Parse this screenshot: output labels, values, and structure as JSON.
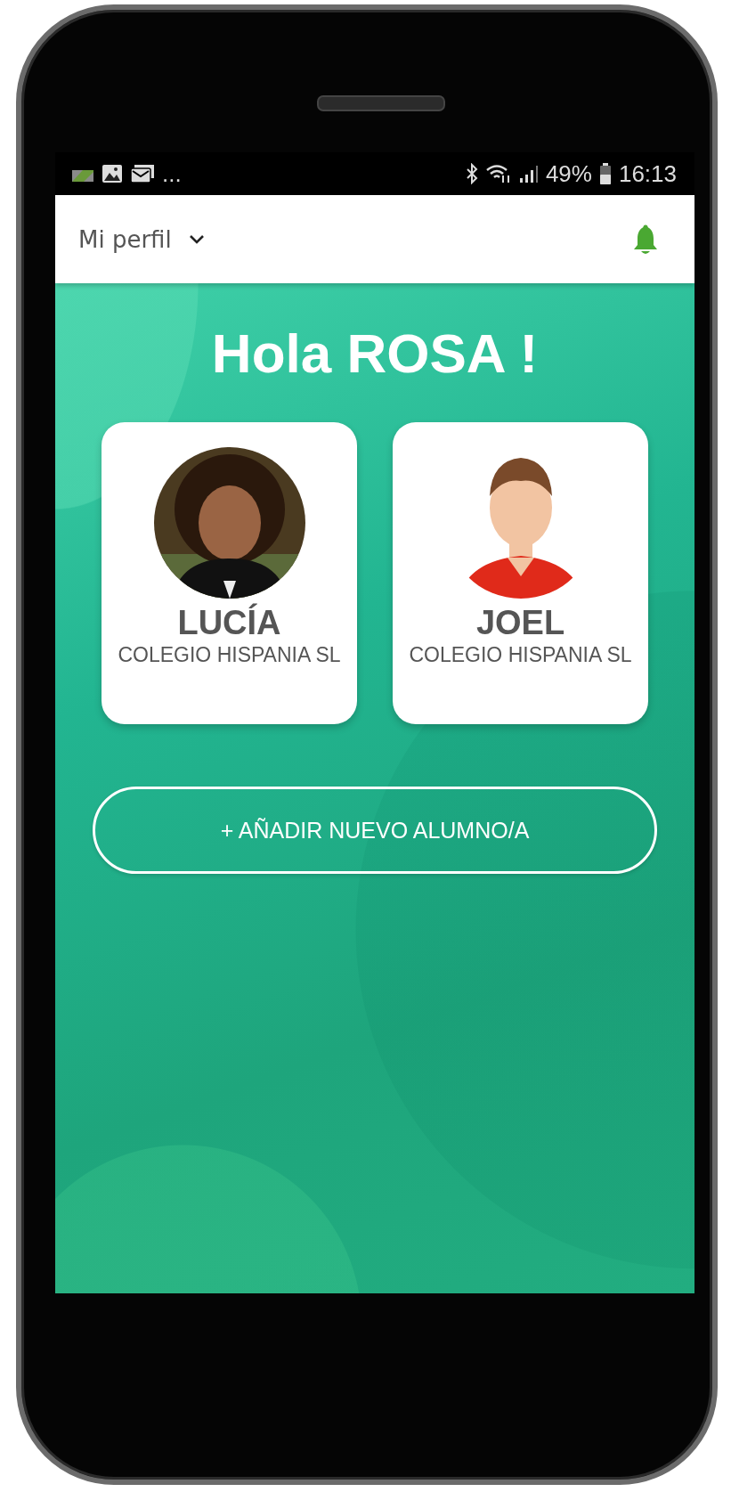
{
  "status_bar": {
    "more": "...",
    "battery": "49%",
    "time": "16:13"
  },
  "app_bar": {
    "title": "Mi perfil"
  },
  "greeting": "Hola ROSA !",
  "students": [
    {
      "name": "LUCÍA",
      "school": "COLEGIO HISPANIA SL"
    },
    {
      "name": "JOEL",
      "school": "COLEGIO HISPANIA SL"
    }
  ],
  "add_button": {
    "label": "+ AÑADIR NUEVO ALUMNO/A"
  }
}
